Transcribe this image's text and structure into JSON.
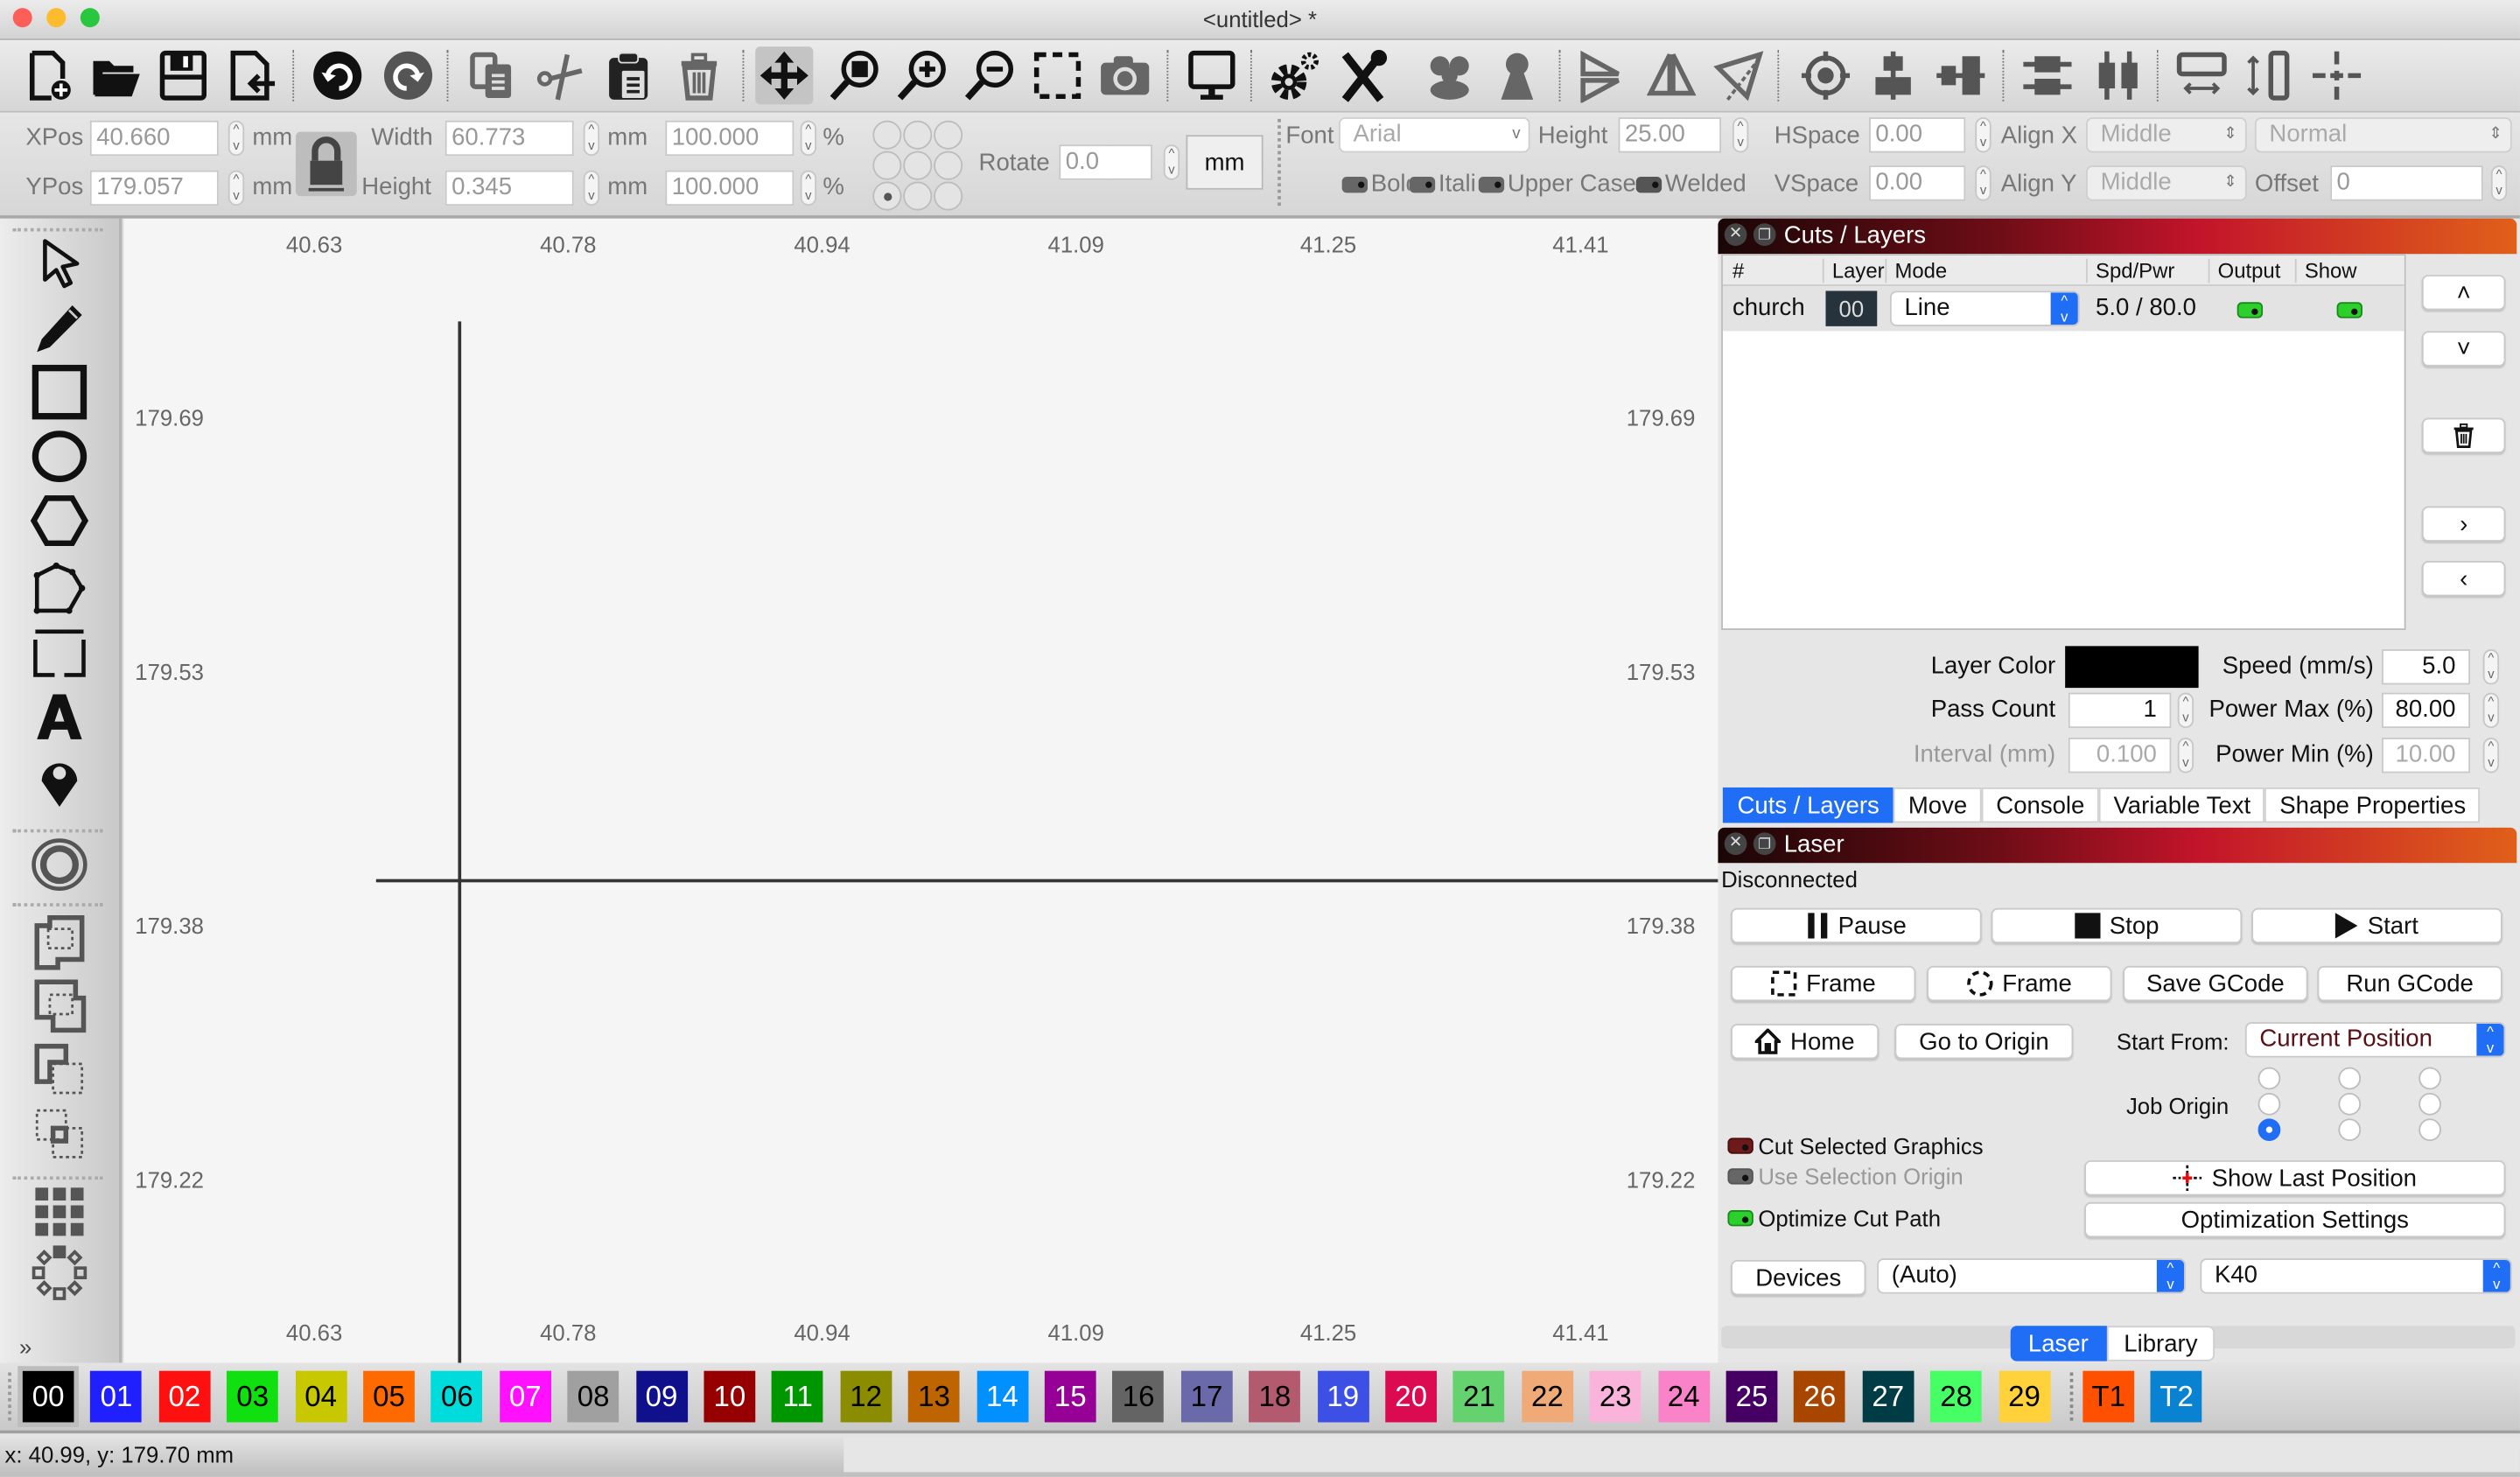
{
  "window": {
    "title": "<untitled> *"
  },
  "toolbar": {
    "icons": [
      "new-file",
      "open-folder",
      "save",
      "import",
      "undo",
      "redo",
      "copy",
      "cut",
      "paste",
      "delete",
      "move",
      "zoom-to-page",
      "zoom-in",
      "zoom-out",
      "zoom-to-frame",
      "camera",
      "monitor",
      "settings",
      "tools",
      "group",
      "ungroup",
      "mirror-horizontal",
      "mirror-vertical",
      "rotate",
      "align-center",
      "align-center-vertical",
      "align-center-horizontal",
      "align-top-bottom",
      "align-left-right",
      "distribute-h",
      "distribute-v",
      "dock-origin"
    ]
  },
  "props": {
    "xpos_label": "XPos",
    "xpos": "40.660",
    "xpos_unit": "mm",
    "ypos_label": "YPos",
    "ypos": "179.057",
    "ypos_unit": "mm",
    "width_label": "Width",
    "width": "60.773",
    "width_unit": "mm",
    "width_pct": "100.000",
    "pct": "%",
    "height_label": "Height",
    "height": "0.345",
    "height_unit": "mm",
    "height_pct": "100.000",
    "rotate_label": "Rotate",
    "rotate": "0.0",
    "unit_button": "mm",
    "font_label": "Font",
    "font": "Arial",
    "text_height_label": "Height",
    "text_height": "25.00",
    "hspace_label": "HSpace",
    "hspace": "0.00",
    "vspace_label": "VSpace",
    "vspace": "0.00",
    "alignx_label": "Align X",
    "alignx": "Middle",
    "aligny_label": "Align Y",
    "aligny": "Middle",
    "style": "Normal",
    "offset_label": "Offset",
    "offset": "0",
    "bold": "Bold",
    "italic": "Italic",
    "upper": "Upper Case",
    "welded": "Welded"
  },
  "canvas": {
    "x_ticks": [
      "40.63",
      "40.78",
      "40.94",
      "41.09",
      "41.25",
      "41.41"
    ],
    "y_ticks": [
      "179.69",
      "179.53",
      "179.38",
      "179.22"
    ]
  },
  "cuts": {
    "title": "Cuts / Layers",
    "headers": [
      "#",
      "Layer",
      "Mode",
      "Spd/Pwr",
      "Output",
      "Show"
    ],
    "rows": [
      {
        "name": "church",
        "layer": "00",
        "mode": "Line",
        "spdpwr": "5.0 / 80.0",
        "output": true,
        "show": true
      }
    ],
    "layer_color_label": "Layer Color",
    "layer_color": "#000000",
    "speed_label": "Speed (mm/s)",
    "speed": "5.0",
    "pass_label": "Pass Count",
    "pass": "1",
    "powermax_label": "Power Max (%)",
    "powermax": "80.00",
    "interval_label": "Interval (mm)",
    "interval": "0.100",
    "powermin_label": "Power Min (%)",
    "powermin": "10.00"
  },
  "dock_tabs": [
    "Cuts / Layers",
    "Move",
    "Console",
    "Variable Text",
    "Shape Properties"
  ],
  "laser": {
    "title": "Laser",
    "status": "Disconnected",
    "pause": "Pause",
    "stop": "Stop",
    "start": "Start",
    "frame1": "Frame",
    "frame2": "Frame",
    "save_gcode": "Save GCode",
    "run_gcode": "Run GCode",
    "home": "Home",
    "go_origin": "Go to Origin",
    "start_from_label": "Start From:",
    "start_from": "Current Position",
    "job_origin_label": "Job Origin",
    "cut_selected": "Cut Selected Graphics",
    "use_selection_origin": "Use Selection Origin",
    "optimize": "Optimize Cut Path",
    "show_last": "Show Last Position",
    "opt_settings": "Optimization Settings",
    "devices": "Devices",
    "port": "(Auto)",
    "device": "K40"
  },
  "bottom_tabs": [
    "Laser",
    "Library"
  ],
  "palette": [
    {
      "id": "00",
      "bg": "#000000",
      "fg": "#ffffff"
    },
    {
      "id": "01",
      "bg": "#2020ff",
      "fg": "#ffffff"
    },
    {
      "id": "02",
      "bg": "#ff1010",
      "fg": "#ffffff"
    },
    {
      "id": "03",
      "bg": "#10e010",
      "fg": "#000000"
    },
    {
      "id": "04",
      "bg": "#c8c800",
      "fg": "#000000"
    },
    {
      "id": "05",
      "bg": "#ff6a00",
      "fg": "#000000"
    },
    {
      "id": "06",
      "bg": "#00dcdc",
      "fg": "#000000"
    },
    {
      "id": "07",
      "bg": "#ff10ff",
      "fg": "#ffffff"
    },
    {
      "id": "08",
      "bg": "#a0a0a0",
      "fg": "#000000"
    },
    {
      "id": "09",
      "bg": "#10108c",
      "fg": "#ffffff"
    },
    {
      "id": "10",
      "bg": "#960000",
      "fg": "#ffffff"
    },
    {
      "id": "11",
      "bg": "#009600",
      "fg": "#ffffff"
    },
    {
      "id": "12",
      "bg": "#8c8c00",
      "fg": "#000000"
    },
    {
      "id": "13",
      "bg": "#be6400",
      "fg": "#000000"
    },
    {
      "id": "14",
      "bg": "#0090ff",
      "fg": "#ffffff"
    },
    {
      "id": "15",
      "bg": "#960096",
      "fg": "#ffffff"
    },
    {
      "id": "16",
      "bg": "#646464",
      "fg": "#000000"
    },
    {
      "id": "17",
      "bg": "#6a6aaa",
      "fg": "#000000"
    },
    {
      "id": "18",
      "bg": "#b45a6e",
      "fg": "#000000"
    },
    {
      "id": "19",
      "bg": "#3c50e6",
      "fg": "#ffffff"
    },
    {
      "id": "20",
      "bg": "#dc0a50",
      "fg": "#ffffff"
    },
    {
      "id": "21",
      "bg": "#64d26e",
      "fg": "#000000"
    },
    {
      "id": "22",
      "bg": "#f0aa78",
      "fg": "#000000"
    },
    {
      "id": "23",
      "bg": "#fab4dc",
      "fg": "#000000"
    },
    {
      "id": "24",
      "bg": "#fa82c8",
      "fg": "#000000"
    },
    {
      "id": "25",
      "bg": "#460064",
      "fg": "#ffffff"
    },
    {
      "id": "26",
      "bg": "#a84600",
      "fg": "#ffffff"
    },
    {
      "id": "27",
      "bg": "#003c46",
      "fg": "#ffffff"
    },
    {
      "id": "28",
      "bg": "#46ff64",
      "fg": "#000000"
    },
    {
      "id": "29",
      "bg": "#ffd23c",
      "fg": "#000000"
    },
    {
      "id": "T1",
      "bg": "#ff5000",
      "fg": "#000000"
    },
    {
      "id": "T2",
      "bg": "#0a82d2",
      "fg": "#ffffff"
    }
  ],
  "status": {
    "coords": "x: 40.99, y: 179.70 mm"
  }
}
